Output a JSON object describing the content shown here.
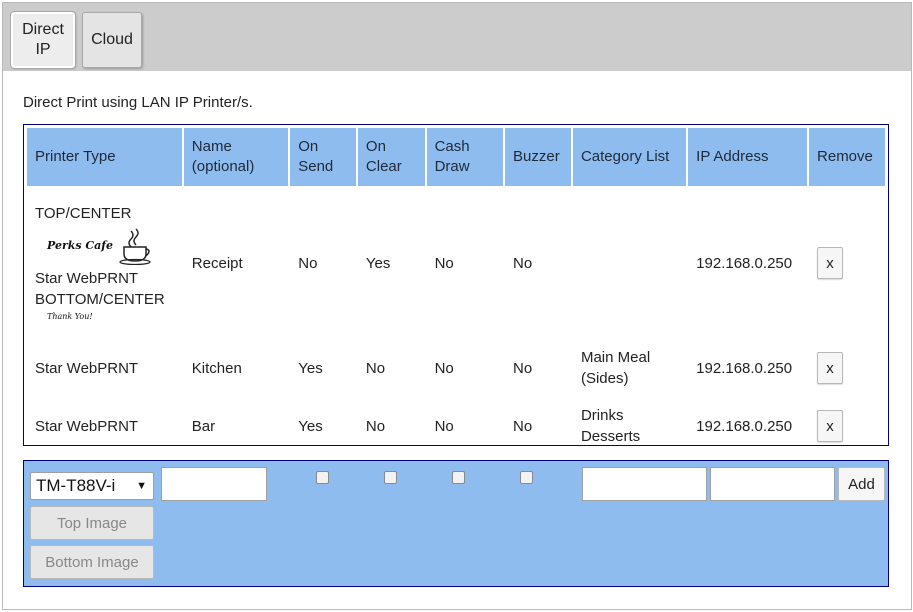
{
  "tabs": [
    {
      "line1": "Direct",
      "line2": "IP"
    },
    {
      "label": "Cloud"
    }
  ],
  "description": "Direct Print using LAN IP Printer/s.",
  "table": {
    "headers": {
      "printer_type": "Printer Type",
      "name_l1": "Name",
      "name_l2": "(optional)",
      "on_send_l1": "On",
      "on_send_l2": "Send",
      "on_clear_l1": "On",
      "on_clear_l2": "Clear",
      "cash_draw_l1": "Cash",
      "cash_draw_l2": "Draw",
      "buzzer": "Buzzer",
      "category_list": "Category List",
      "ip_address": "IP Address",
      "remove": "Remove"
    },
    "rows": [
      {
        "type_top": "TOP/CENTER",
        "logo_text": "Perks Cafe",
        "type": "Star WebPRNT",
        "type_bottom": "BOTTOM/CENTER",
        "thanks_text": "Thank You!",
        "name": "Receipt",
        "on_send": "No",
        "on_clear": "Yes",
        "cash_draw": "No",
        "buzzer": "No",
        "category_l1": "",
        "category_l2": "",
        "ip": "192.168.0.250",
        "remove": "x"
      },
      {
        "type": "Star WebPRNT",
        "name": "Kitchen",
        "on_send": "Yes",
        "on_clear": "No",
        "cash_draw": "No",
        "buzzer": "No",
        "category_l1": "Main Meal",
        "category_l2": "(Sides)",
        "ip": "192.168.0.250",
        "remove": "x"
      },
      {
        "type": "Star WebPRNT",
        "name": "Bar",
        "on_send": "Yes",
        "on_clear": "No",
        "cash_draw": "No",
        "buzzer": "No",
        "category_l1": "Drinks",
        "category_l2": "Desserts",
        "ip": "192.168.0.250",
        "remove": "x"
      }
    ]
  },
  "add_form": {
    "printer_select": "TM-T88V-i",
    "top_image_label": "Top Image",
    "bottom_image_label": "Bottom Image",
    "add_label": "Add",
    "on_send_checked": false,
    "on_clear_checked": false,
    "cash_draw_checked": false,
    "buzzer_checked": false
  },
  "colors": {
    "header_bg": "#8fbcef",
    "tabbar_bg": "#cccccc",
    "border_navy": "#000080"
  }
}
